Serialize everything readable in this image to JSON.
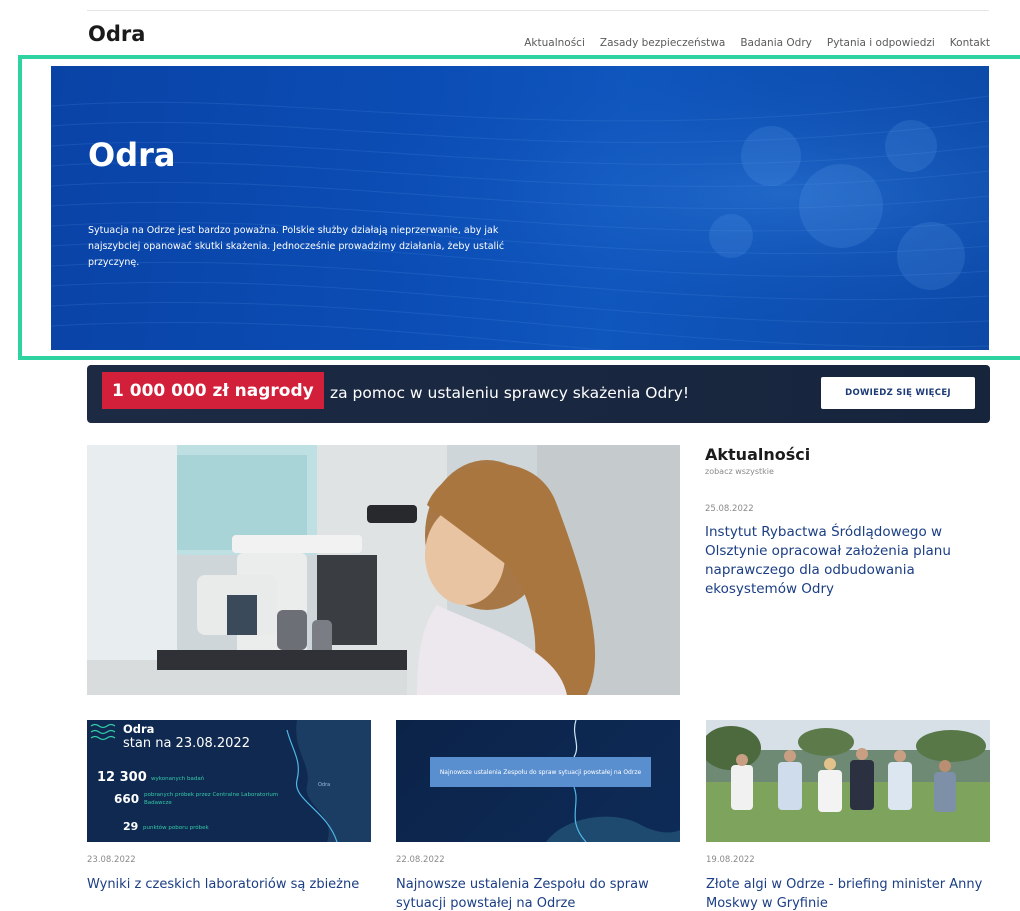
{
  "header": {
    "logo": "Odra",
    "nav": [
      "Aktualności",
      "Zasady bezpieczeństwa",
      "Badania Odry",
      "Pytania i odpowiedzi",
      "Kontakt"
    ]
  },
  "hero": {
    "title": "Odra",
    "text": "Sytuacja na Odrze jest bardzo poważna. Polskie służby działają nieprzerwanie, aby jak najszybciej opanować skutki skażenia. Jednocześnie prowadzimy działania, żeby ustalić przyczynę.",
    "accent": "#2fd3a2"
  },
  "banner": {
    "prize": "1 000 000 zł nagrody",
    "text": "za pomoc w ustaleniu sprawcy skażenia Odry!",
    "button": "DOWIEDZ SIĘ WIĘCEJ",
    "prize_color": "#d2203b"
  },
  "news": {
    "title": "Aktualności",
    "see_all": "zobacz wszystkie",
    "featured": {
      "date": "25.08.2022",
      "headline": "Instytut Rybactwa Śródlądowego w Olsztynie opracował założenia planu naprawczego dla odbudowania ekosystemów Odry"
    }
  },
  "cards": [
    {
      "date": "23.08.2022",
      "title": "Wyniki z czeskich laboratoriów są zbieżne",
      "thumb": {
        "title": "Odra",
        "subtitle": "stan na 23.08.2022",
        "stats": [
          {
            "value": "12 300",
            "label": "wykonanych badań"
          },
          {
            "value": "660",
            "label": "pobranych próbek przez Centralne Laboratorium Badawcze"
          },
          {
            "value": "29",
            "label": "punktów poboru próbek"
          }
        ],
        "river_label": "Odra"
      }
    },
    {
      "date": "22.08.2022",
      "title": "Najnowsze ustalenia Zespołu do spraw sytuacji powstałej na Odrze",
      "thumb": {
        "box_text": "Najnowsze ustalenia Zespołu do spraw sytuacji powstałej na Odrze"
      }
    },
    {
      "date": "19.08.2022",
      "title": "Złote algi w Odrze - briefing minister Anny Moskwy w Gryfinie"
    }
  ]
}
